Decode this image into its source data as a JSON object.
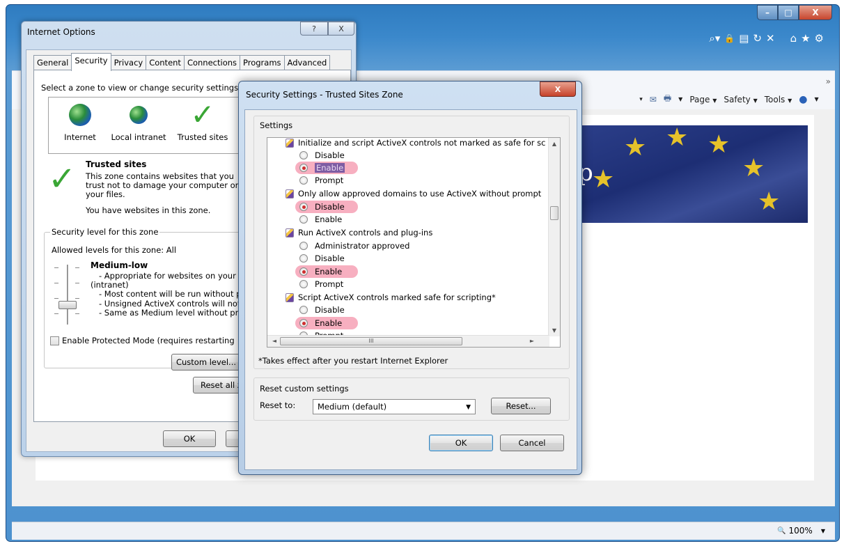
{
  "browser": {
    "window_controls": {
      "minimize": "–",
      "maximize": "□",
      "close": "X"
    },
    "address_icons": [
      "search-icon",
      "lock-icon",
      "compat-icon",
      "refresh-icon",
      "stop-icon"
    ],
    "address_glyphs": {
      "search": "⌕▾",
      "lock": "🔒",
      "compat": "▤",
      "refresh": "↻",
      "stop": "✕"
    },
    "fav_icons": {
      "home": "⌂",
      "star": "★",
      "gear": "⚙"
    },
    "command_bar": {
      "icons": {
        "feeds": "▾",
        "mail": "✉",
        "print": "🖶",
        "help": "●",
        "more": "»"
      },
      "page": "Page",
      "safety": "Safety",
      "tools": "Tools",
      "caret": "▼"
    },
    "banner_text": "p",
    "zoom": "100%",
    "zoom_icon": "🔍",
    "zoom_caret": "▼"
  },
  "internet_options": {
    "title": "Internet Options",
    "help_glyph": "?",
    "close_glyph": "X",
    "tabs": [
      "General",
      "Security",
      "Privacy",
      "Content",
      "Connections",
      "Programs",
      "Advanced"
    ],
    "instruction": "Select a zone to view or change security settings.",
    "zones": [
      {
        "label": "Internet",
        "icon": "globe-icon"
      },
      {
        "label": "Local intranet",
        "icon": "intranet-icon"
      },
      {
        "label": "Trusted sites",
        "icon": "check-icon"
      }
    ],
    "check_glyph": "✓",
    "zone_title": "Trusted sites",
    "zone_description": "This zone contains websites that you trust not to damage your computer or your files.",
    "zone_has_sites": "You have websites in this zone.",
    "level_group_label": "Security level for this zone",
    "allowed_levels": "Allowed levels for this zone: All",
    "level_name": "Medium-low",
    "level_details": [
      "- Appropriate for websites on your",
      "(intranet)",
      "- Most content will be run without p",
      "- Unsigned ActiveX controls will not",
      "- Same as Medium level without pr"
    ],
    "protected_mode": "Enable Protected Mode (requires restarting",
    "custom_level_button": "Custom level...",
    "reset_all_button": "Reset all zo",
    "ok_button": "OK",
    "cancel_button": ""
  },
  "security_settings": {
    "title": "Security Settings - Trusted Sites Zone",
    "close_glyph": "X",
    "settings_label": "Settings",
    "items": {
      "init_script": {
        "label": "Initialize and script ActiveX controls not marked as safe for sc",
        "options": [
          "Disable",
          "Enable",
          "Prompt"
        ],
        "selected": "Enable"
      },
      "approved_domains": {
        "label": "Only allow approved domains to use ActiveX without prompt",
        "options": [
          "Disable",
          "Enable"
        ],
        "selected": "Disable"
      },
      "run_activex": {
        "label": "Run ActiveX controls and plug-ins",
        "options": [
          "Administrator approved",
          "Disable",
          "Enable",
          "Prompt"
        ],
        "selected": "Enable"
      },
      "script_safe": {
        "label": "Script ActiveX controls marked safe for scripting*",
        "options": [
          "Disable",
          "Enable",
          "Prompt"
        ],
        "selected": "Enable"
      }
    },
    "scroll_glyphs": {
      "up": "▲",
      "down": "▼",
      "left": "◄",
      "right": "►",
      "grip": "III"
    },
    "footnote": "*Takes effect after you restart Internet Explorer",
    "reset_group_label": "Reset custom settings",
    "reset_to_label": "Reset to:",
    "reset_to_value": "Medium (default)",
    "dropdown_glyph": "▼",
    "reset_button": "Reset...",
    "ok_button": "OK",
    "cancel_button": "Cancel"
  },
  "colors": {
    "highlight": "#f06e8c",
    "selection": "#7e5ca3",
    "check_green": "#3aa635",
    "frame_blue": "#3b88cb"
  }
}
